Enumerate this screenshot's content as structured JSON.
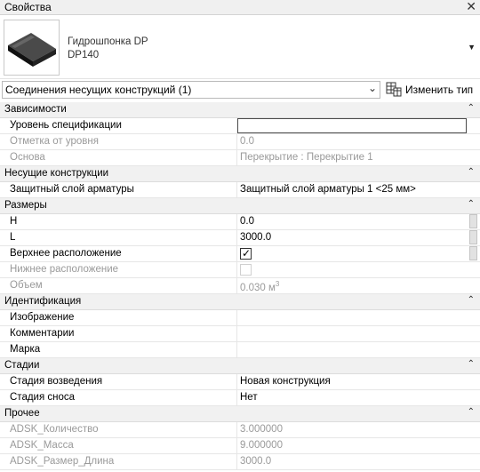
{
  "window": {
    "title": "Свойства",
    "close_glyph": "✕"
  },
  "type_selector": {
    "family": "Гидрошпонка DP",
    "type": "DP140",
    "thumbnail_icon": "profile-bar-icon"
  },
  "filter": {
    "selected": "Соединения несущих конструкций (1)",
    "edit_type_label": "Изменить тип"
  },
  "sections": {
    "dependencies": {
      "label": "Зависимости",
      "rows": [
        {
          "name": "Уровень спецификации",
          "value": ""
        },
        {
          "name": "Отметка от уровня",
          "value": "0.0"
        },
        {
          "name": "Основа",
          "value": "Перекрытие : Перекрытие 1"
        }
      ]
    },
    "structural": {
      "label": "Несущие конструкции",
      "rows": [
        {
          "name": "Защитный слой арматуры",
          "value": "Защитный слой арматуры 1 <25 мм>"
        }
      ]
    },
    "dimensions": {
      "label": "Размеры",
      "rows": [
        {
          "name": "H",
          "value": "0.0"
        },
        {
          "name": "L",
          "value": "3000.0"
        },
        {
          "name": "Верхнее расположение",
          "checked": true
        },
        {
          "name": "Нижнее расположение",
          "checked": false
        },
        {
          "name": "Объем",
          "value": "0.030 м",
          "unit_sup": "3"
        }
      ]
    },
    "identification": {
      "label": "Идентификация",
      "rows": [
        {
          "name": "Изображение",
          "value": ""
        },
        {
          "name": "Комментарии",
          "value": ""
        },
        {
          "name": "Марка",
          "value": ""
        }
      ]
    },
    "phasing": {
      "label": "Стадии",
      "rows": [
        {
          "name": "Стадия возведения",
          "value": "Новая конструкция"
        },
        {
          "name": "Стадия сноса",
          "value": "Нет"
        }
      ]
    },
    "other": {
      "label": "Прочее",
      "rows": [
        {
          "name": "ADSK_Количество",
          "value": "3.000000"
        },
        {
          "name": "ADSK_Масса",
          "value": "9.000000"
        },
        {
          "name": "ADSK_Размер_Длина",
          "value": "3000.0"
        }
      ]
    }
  },
  "collapse_glyph": "⌃"
}
